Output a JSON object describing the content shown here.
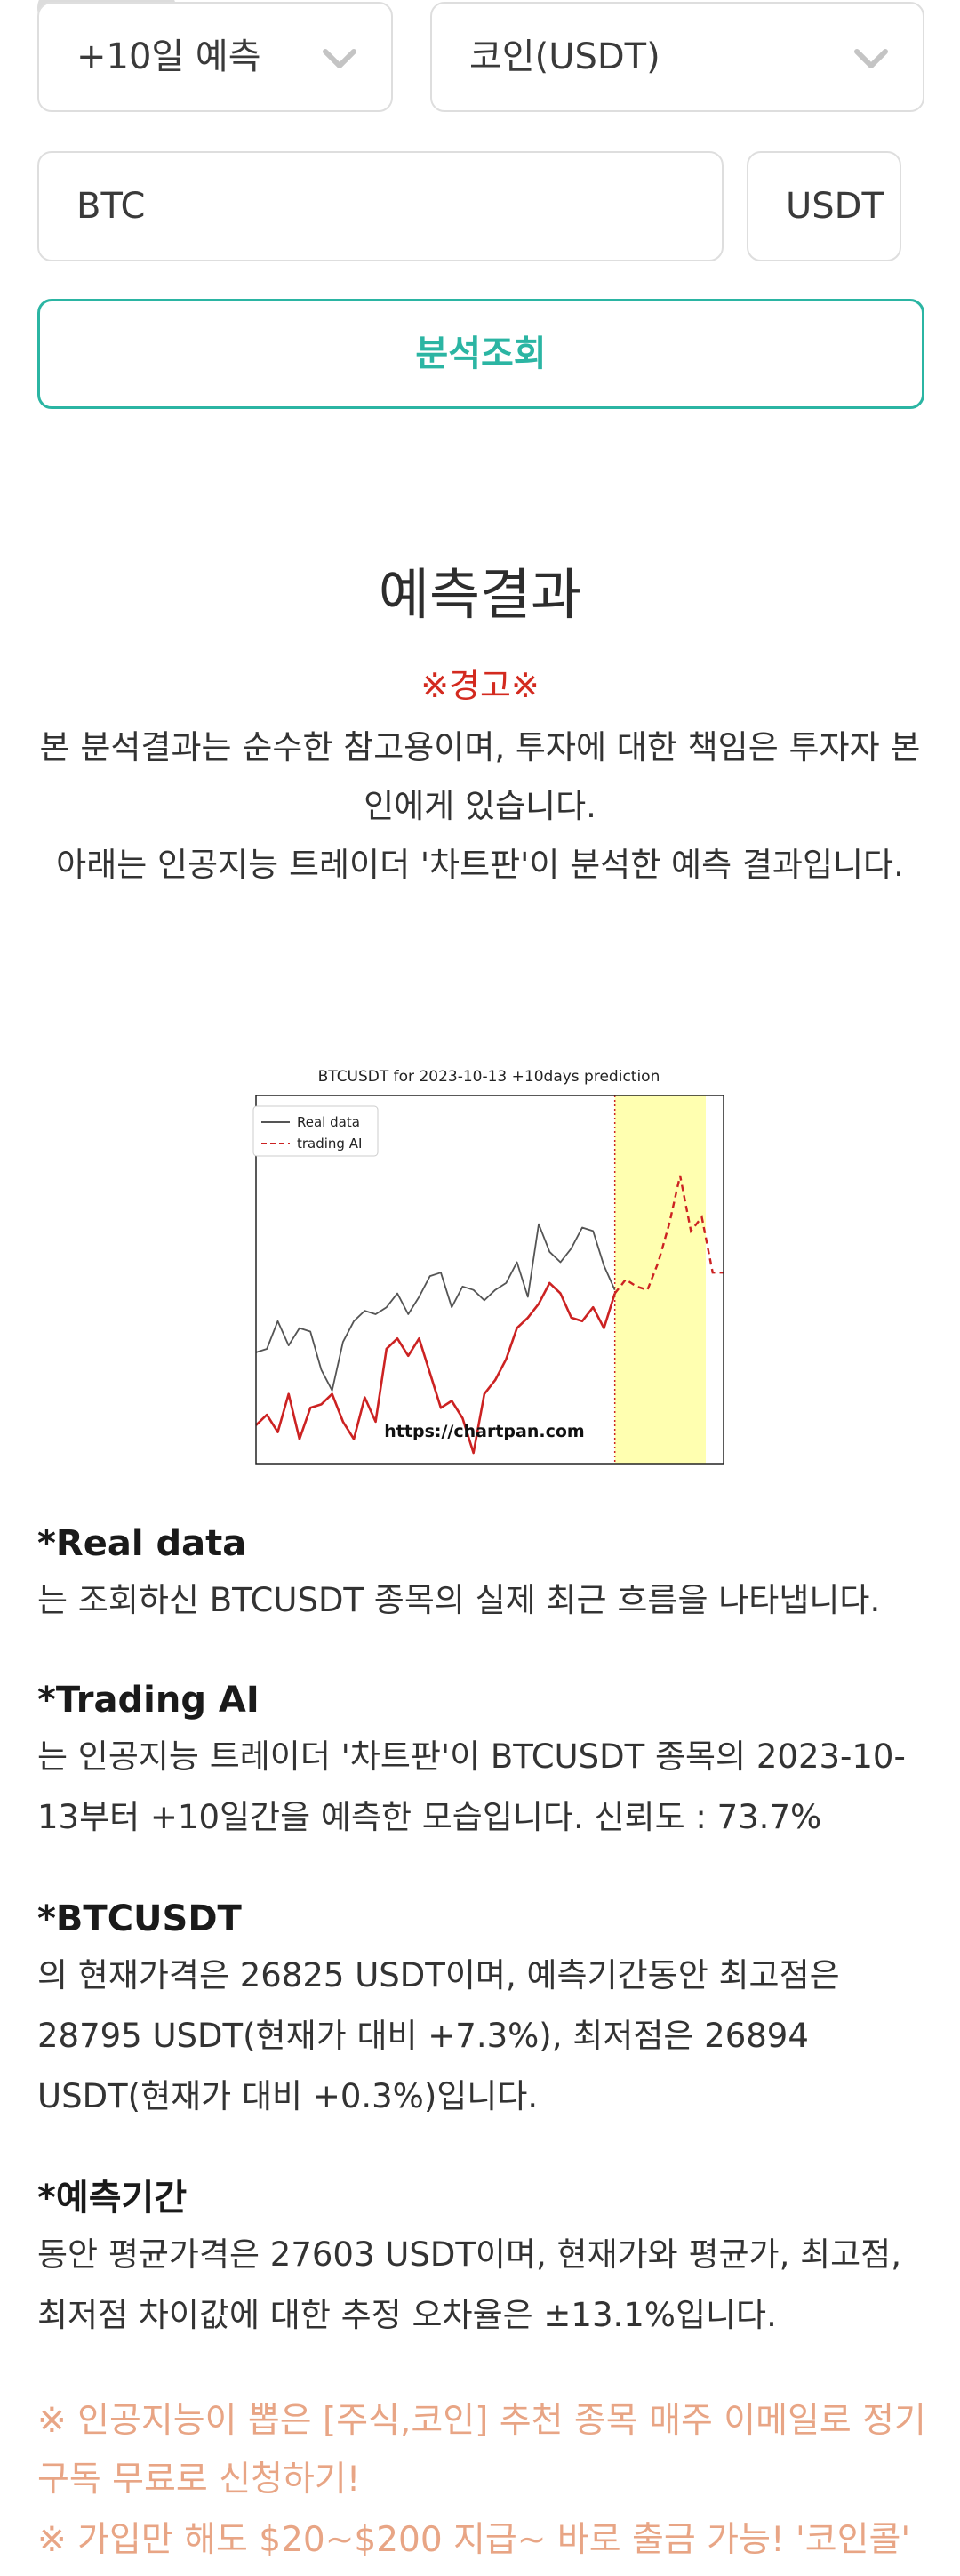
{
  "selects": {
    "period": "+10일 예측",
    "type": "코인(USDT)"
  },
  "inputs": {
    "symbol": "BTC",
    "quote": "USDT"
  },
  "analyze_label": "분석조회",
  "result": {
    "title": "예측결과",
    "warning_title": "※경고※",
    "disclaimer_1": "본 분석결과는 순수한 참고용이며, 투자에 대한 책임은 투자자 본인에게 있습니다.",
    "disclaimer_2": "아래는 인공지능 트레이더 '차트판'이 분석한 예측 결과입니다."
  },
  "chart_data": {
    "type": "line",
    "title": "BTCUSDT for 2023-10-13 +10days prediction",
    "watermark": "https://chartpan.com",
    "legend_position": "top-left",
    "grid": false,
    "axes_ticks_visible": false,
    "ylim": [
      0,
      100
    ],
    "prediction_start_index": 33,
    "prediction_end_index": 43,
    "colors": {
      "real": "#555555",
      "ai": "#cc2222",
      "highlight": "#ffffb0"
    },
    "series": [
      {
        "name": "Real data",
        "style": "solid",
        "x": [
          0,
          1,
          2,
          3,
          4,
          5,
          6,
          7,
          8,
          9,
          10,
          11,
          12,
          13,
          14,
          15,
          16,
          17,
          18,
          19,
          20,
          21,
          22,
          23,
          24,
          25,
          26,
          27,
          28,
          29,
          30,
          31,
          32,
          33
        ],
        "values": [
          29,
          30,
          38,
          31,
          36,
          35,
          24,
          18,
          32,
          38,
          41,
          40,
          42,
          46,
          40,
          45,
          51,
          52,
          42,
          48,
          47,
          44,
          47,
          49,
          55,
          45,
          66,
          58,
          55,
          59,
          65,
          64,
          54,
          47
        ]
      },
      {
        "name": "trading AI",
        "style": "dashed",
        "x": [
          0,
          1,
          2,
          3,
          4,
          5,
          6,
          7,
          8,
          9,
          10,
          11,
          12,
          13,
          14,
          15,
          16,
          17,
          18,
          19,
          20,
          21,
          22,
          23,
          24,
          25,
          26,
          27,
          28,
          29,
          30,
          31,
          32,
          33,
          34,
          35,
          36,
          37,
          38,
          39,
          40,
          41,
          42,
          43
        ],
        "values": [
          8,
          11,
          6,
          17,
          4,
          13,
          14,
          17,
          9,
          4,
          16,
          9,
          30,
          33,
          28,
          33,
          23,
          13,
          15,
          10,
          0,
          17,
          21,
          27,
          36,
          39,
          43,
          49,
          46,
          39,
          38,
          42,
          36,
          46,
          50,
          48,
          47,
          55,
          66,
          80,
          64,
          68,
          52,
          52
        ]
      }
    ]
  },
  "notes": [
    {
      "heading": "*Real data",
      "text": "는 조회하신 BTCUSDT 종목의 실제 최근 흐름을 나타냅니다."
    },
    {
      "heading": "*Trading AI",
      "text": "는 인공지능 트레이더 '차트판'이 BTCUSDT 종목의 2023-10-13부터 +10일간을 예측한 모습입니다. 신뢰도 : 73.7%"
    },
    {
      "heading": "*BTCUSDT",
      "text": "의 현재가격은 26825 USDT이며, 예측기간동안 최고점은 28795 USDT(현재가 대비 +7.3%), 최저점은 26894 USDT(현재가 대비 +0.3%)입니다."
    },
    {
      "heading": "*예측기간",
      "text": "동안 평균가격은 27603 USDT이며, 현재가와 평균가, 최고점, 최저점 차이값에 대한 추정 오차율은 ±13.1%입니다."
    }
  ],
  "promo": {
    "line1": "※ 인공지능이 뽑은 [주식,코인] 추천 종목 매주 이메일로 정기구독 무료로 신청하기!",
    "line2": "※ 가입만 해도 $20~$200 지급~ 바로 출금 가능! '코인콜'"
  }
}
